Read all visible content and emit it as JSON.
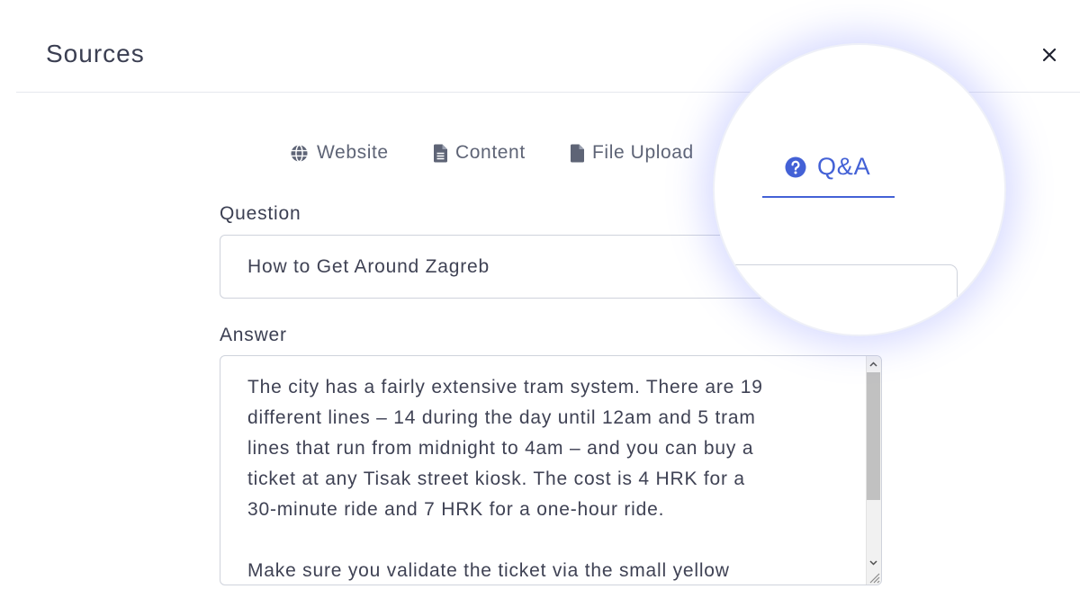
{
  "header": {
    "title": "Sources",
    "close_icon": "close-icon"
  },
  "tabs": [
    {
      "label": "Website",
      "icon": "globe-icon",
      "active": false
    },
    {
      "label": "Content",
      "icon": "document-icon",
      "active": false
    },
    {
      "label": "File Upload",
      "icon": "file-icon",
      "active": false
    },
    {
      "label": "Q&A",
      "icon": "question-circle-icon",
      "active": true
    }
  ],
  "form": {
    "question_label": "Question",
    "question_value": "How to Get Around Zagreb",
    "answer_label": "Answer",
    "answer_value": "The city has a fairly extensive tram system. There are 19\ndifferent lines – 14 during the day until 12am and 5 tram\nlines that run from midnight to 4am – and you can buy a\nticket at any Tisak street kiosk. The cost is 4 HRK for a\n30-minute ride and 7 HRK for a one-hour ride.\n\nMake sure you validate the ticket via the small yellow"
  },
  "colors": {
    "accent": "#4361d6",
    "text": "#3f4254",
    "muted": "#5e6476",
    "border": "#cfd3dc",
    "magnifier_glow": "#7882ff"
  }
}
